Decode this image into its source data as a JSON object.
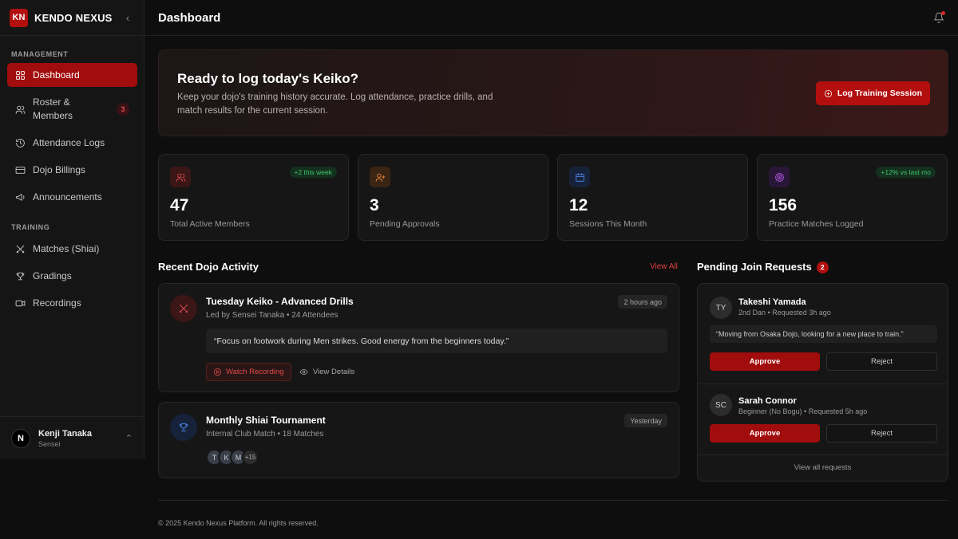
{
  "brand": {
    "logo": "KN",
    "name": "KENDO NEXUS",
    "collapse_icon": "chevron-left-icon"
  },
  "sidebar": {
    "sections": [
      {
        "label": "MANAGEMENT",
        "items": [
          {
            "label": "Dashboard",
            "icon": "grid-icon",
            "active": true
          },
          {
            "label": "Roster & Members",
            "icon": "users-icon",
            "badge": "3"
          },
          {
            "label": "Attendance Logs",
            "icon": "history-icon"
          },
          {
            "label": "Dojo Billings",
            "icon": "credit-card-icon"
          },
          {
            "label": "Announcements",
            "icon": "megaphone-icon"
          }
        ]
      },
      {
        "label": "TRAINING",
        "items": [
          {
            "label": "Matches (Shiai)",
            "icon": "swords-icon"
          },
          {
            "label": "Gradings",
            "icon": "trophy-icon"
          },
          {
            "label": "Recordings",
            "icon": "video-icon"
          }
        ]
      }
    ]
  },
  "user": {
    "avatar": "N",
    "name": "Kenji Tanaka",
    "role": "Sensei"
  },
  "header": {
    "title": "Dashboard"
  },
  "hero": {
    "title": "Ready to log today's Keiko?",
    "text": "Keep your dojo's training history accurate. Log attendance, practice drills, and match results for the current session.",
    "button": "Log Training Session"
  },
  "stats": [
    {
      "value": "47",
      "label": "Total Active Members",
      "badge": "+2 this week",
      "icon": "users-icon",
      "color": "#e04a4a"
    },
    {
      "value": "3",
      "label": "Pending Approvals",
      "badge": "",
      "icon": "user-plus-icon",
      "color": "#e8843a"
    },
    {
      "value": "12",
      "label": "Sessions This Month",
      "badge": "",
      "icon": "calendar-icon",
      "color": "#4a7fe0"
    },
    {
      "value": "156",
      "label": "Practice Matches Logged",
      "badge": "+12% vs last mo",
      "icon": "target-icon",
      "color": "#b05ae0"
    }
  ],
  "activity": {
    "title": "Recent Dojo Activity",
    "view_all": "View All",
    "items": [
      {
        "title": "Tuesday Keiko - Advanced Drills",
        "sub": "Led by Sensei Tanaka • 24 Attendees",
        "time": "2 hours ago",
        "quote": "“Focus on footwork during Men strikes. Good energy from the beginners today.”",
        "watch": "Watch Recording",
        "details": "View Details"
      },
      {
        "title": "Monthly Shiai Tournament",
        "sub": "Internal Club Match • 18 Matches",
        "time": "Yesterday",
        "avatars": [
          "T",
          "K",
          "M"
        ],
        "more": "+15"
      }
    ]
  },
  "requests": {
    "title": "Pending Join Requests",
    "count": "2",
    "items": [
      {
        "initials": "TY",
        "name": "Takeshi Yamada",
        "meta": "2nd Dan • Requested 3h ago",
        "message": "“Moving from Osaka Dojo, looking for a new place to train.”",
        "approve": "Approve",
        "reject": "Reject"
      },
      {
        "initials": "SC",
        "name": "Sarah Connor",
        "meta": "Beginner (No Bogu) • Requested 5h ago",
        "approve": "Approve",
        "reject": "Reject"
      }
    ],
    "view_all": "View all requests"
  },
  "footer": {
    "text": "© 2025 Kendo Nexus Platform. All rights reserved."
  }
}
